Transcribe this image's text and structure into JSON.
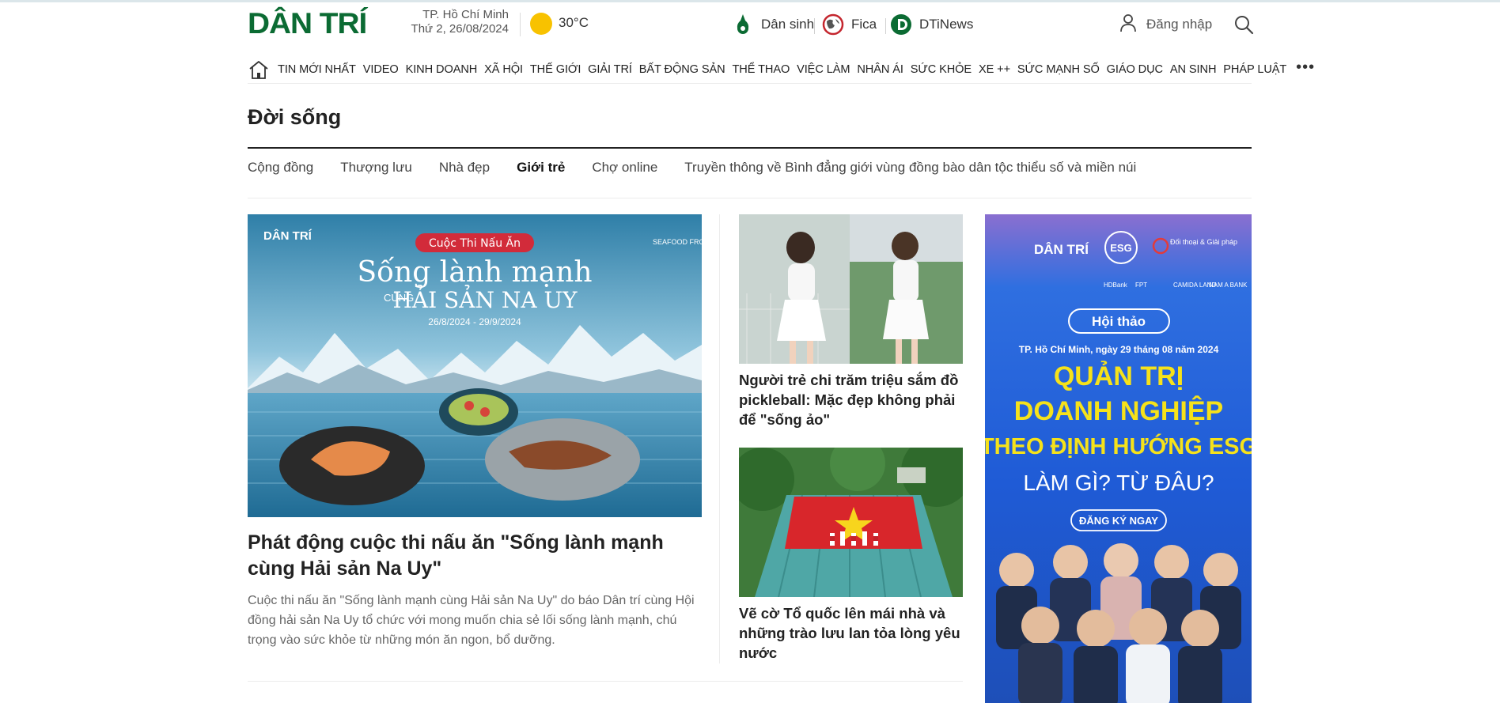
{
  "header": {
    "logo": "DÂN TRÍ",
    "city": "TP. Hồ Chí Minh",
    "date": "Thứ 2, 26/08/2024",
    "temperature": "30°C",
    "services": [
      {
        "label": "Dân sinh",
        "icon": "dan-sinh-icon"
      },
      {
        "label": "Fica",
        "icon": "fica-globe-icon"
      },
      {
        "label": "DTiNews",
        "icon": "dtinews-icon"
      }
    ],
    "login_label": "Đăng nhập"
  },
  "nav": {
    "items": [
      "TIN MỚI NHẤT",
      "VIDEO",
      "KINH DOANH",
      "XÃ HỘI",
      "THẾ GIỚI",
      "GIẢI TRÍ",
      "BẤT ĐỘNG SẢN",
      "THỂ THAO",
      "VIỆC LÀM",
      "NHÂN ÁI",
      "SỨC KHỎE",
      "XE ++",
      "SỨC MẠNH SỐ",
      "GIÁO DỤC",
      "AN SINH",
      "PHÁP LUẬT"
    ],
    "more": "•••"
  },
  "section": {
    "title": "Đời sống",
    "subnav": [
      "Cộng đồng",
      "Thượng lưu",
      "Nhà đẹp",
      "Giới trẻ",
      "Chợ online",
      "Truyền thông về Bình đẳng giới vùng đồng bào dân tộc thiểu số và miền núi"
    ],
    "active_index": 3
  },
  "main_article": {
    "image": {
      "brand": "DÂN TRÍ",
      "badge": "Cuộc Thi Nấu Ăn",
      "headline1": "Sống lành mạnh",
      "headline_small": "CÙNG",
      "headline2": "HẢI SẢN NA UY",
      "dates": "26/8/2024 - 29/9/2024",
      "partner": "SEAFOOD FROM NORWAY"
    },
    "title": "Phát động cuộc thi nấu ăn \"Sống lành mạnh cùng Hải sản Na Uy\"",
    "sapo": "Cuộc thi nấu ăn \"Sống lành mạnh cùng Hải sản Na Uy\" do báo Dân trí cùng Hội đồng hải sản Na Uy tổ chức với mong muốn chia sẻ lối sống lành mạnh, chú trọng vào sức khỏe từ những món ăn ngon, bổ dưỡng."
  },
  "side_articles": [
    {
      "title": "Người trẻ chi trăm triệu sắm đồ pickleball: Mặc đẹp không phải để \"sống ảo\""
    },
    {
      "title": "Vẽ cờ Tổ quốc lên mái nhà và những trào lưu lan tỏa lòng yêu nước"
    }
  ],
  "ad": {
    "brand": "DÂN TRÍ",
    "esg": "ESG",
    "partner": "Đối thoại & Giải pháp",
    "sponsors": [
      "HDBank",
      "FPT",
      "CAMIDA LAND",
      "NAM A BANK"
    ],
    "tag": "Hội thảo",
    "date_line": "TP. Hồ Chí Minh, ngày 29 tháng 08 năm 2024",
    "line1": "QUẢN TRỊ",
    "line2": "DOANH NGHIỆP",
    "line3": "THEO ĐỊNH HƯỚNG ESG",
    "line4": "LÀM GÌ? TỪ ĐÂU?",
    "cta": "ĐĂNG KÝ NGAY"
  },
  "colors": {
    "brand_green": "#0b6b33",
    "text": "#222222",
    "muted": "#666666",
    "sun": "#f8c200",
    "ad_yellow": "#f6e21a"
  }
}
